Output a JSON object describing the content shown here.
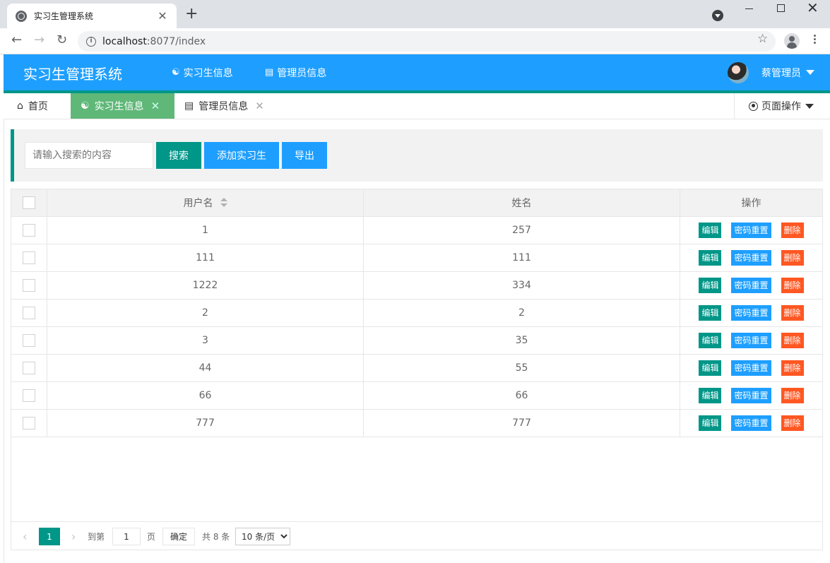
{
  "browser": {
    "tab_title": "实习生管理系统",
    "close_glyph": "✕",
    "new_tab_glyph": "+",
    "url_host": "localhost",
    "url_rest": ":8077/index"
  },
  "app": {
    "logo": "实习生管理系统",
    "nav": [
      {
        "label": "实习生信息",
        "icon": "users-icon"
      },
      {
        "label": "管理员信息",
        "icon": "clipboard-icon"
      }
    ],
    "user_name": "蔡管理员"
  },
  "tabs": [
    {
      "label": "首页",
      "icon": "home-icon",
      "closable": false
    },
    {
      "label": "实习生信息",
      "icon": "users-icon",
      "closable": true,
      "active": true
    },
    {
      "label": "管理员信息",
      "icon": "clipboard-icon",
      "closable": true
    }
  ],
  "page_ops_label": "页面操作",
  "search": {
    "placeholder": "请输入搜索的内容",
    "search_label": "搜索",
    "add_label": "添加实习生",
    "export_label": "导出"
  },
  "table": {
    "headers": {
      "username": "用户名",
      "name": "姓名",
      "ops": "操作"
    },
    "rows": [
      {
        "username": "1",
        "name": "257"
      },
      {
        "username": "111",
        "name": "111"
      },
      {
        "username": "1222",
        "name": "334"
      },
      {
        "username": "2",
        "name": "2"
      },
      {
        "username": "3",
        "name": "35"
      },
      {
        "username": "44",
        "name": "55"
      },
      {
        "username": "66",
        "name": "66"
      },
      {
        "username": "777",
        "name": "777"
      }
    ],
    "row_actions": {
      "edit": "编辑",
      "reset": "密码重置",
      "delete": "删除"
    }
  },
  "pager": {
    "current_page": "1",
    "goto_prefix": "到第",
    "goto_value": "1",
    "goto_suffix": "页",
    "confirm": "确定",
    "total": "共 8 条",
    "page_size": "10 条/页"
  },
  "colors": {
    "primary_blue": "#1e9fff",
    "primary_green": "#009688",
    "tab_active": "#5fb878",
    "danger": "#ff5722"
  }
}
